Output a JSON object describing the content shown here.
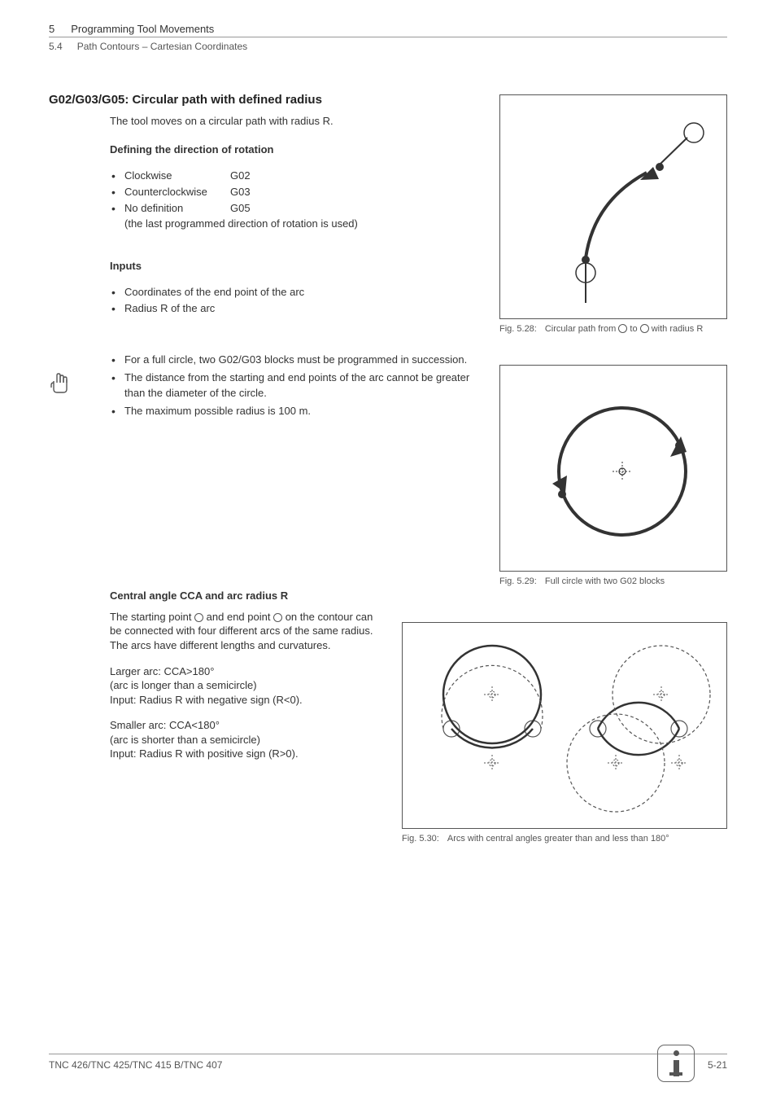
{
  "header": {
    "chapter_num": "5",
    "chapter_title": "Programming Tool Movements",
    "section_num": "5.4",
    "section_title": "Path Contours – Cartesian Coordinates"
  },
  "main": {
    "heading": "G02/G03/G05: Circular path with defined radius",
    "intro": "The tool moves on a circular path with radius R.",
    "rotation_heading": "Defining the direction of rotation",
    "rotation": [
      {
        "label": "Clockwise",
        "code": "G02",
        "note": ""
      },
      {
        "label": "Counterclockwise",
        "code": "G03",
        "note": ""
      },
      {
        "label": "No definition",
        "code": "G05",
        "note": "(the last programmed direction of rotation is used)"
      }
    ],
    "inputs_heading": "Inputs",
    "inputs": [
      "Coordinates of the end point of the arc",
      "Radius R of the arc"
    ],
    "notes": [
      "For a full circle, two G02/G03 blocks must be programmed in succession.",
      "The distance from the starting and end points of the arc cannot be greater than the diameter of the circle.",
      "The maximum possible radius is 100 m."
    ]
  },
  "cca": {
    "heading": "Central angle CCA and arc radius R",
    "desc_pre": "The starting point ",
    "desc_mid": " and end point ",
    "desc_post": " on the contour can be connected with four different arcs of the same radius. The arcs have different lengths and curvatures.",
    "larger_label": "Larger arc: ",
    "larger_val": "CCA>180°",
    "larger_note1": "(arc is longer than a semicircle)",
    "larger_note2": "Input: Radius R with negative sign (R<0).",
    "smaller_label": "Smaller arc: ",
    "smaller_val": "CCA<180°",
    "smaller_note1": "(arc is shorter than a semicircle)",
    "smaller_note2": "Input: Radius R with positive sign (R>0)."
  },
  "captions": {
    "fig528_label": "Fig. 5.28:",
    "fig528_text_pre": "Circular path from ",
    "fig528_text_mid": " to ",
    "fig528_text_post": " with radius R",
    "fig529_label": "Fig. 5.29:",
    "fig529_text": "Full circle with two G02 blocks",
    "fig530_label": "Fig. 5.30:",
    "fig530_text": "Arcs with central angles greater than and less than 180°"
  },
  "footer": {
    "left": "TNC 426/TNC 425/TNC 415 B/TNC 407",
    "right": "5-21"
  }
}
